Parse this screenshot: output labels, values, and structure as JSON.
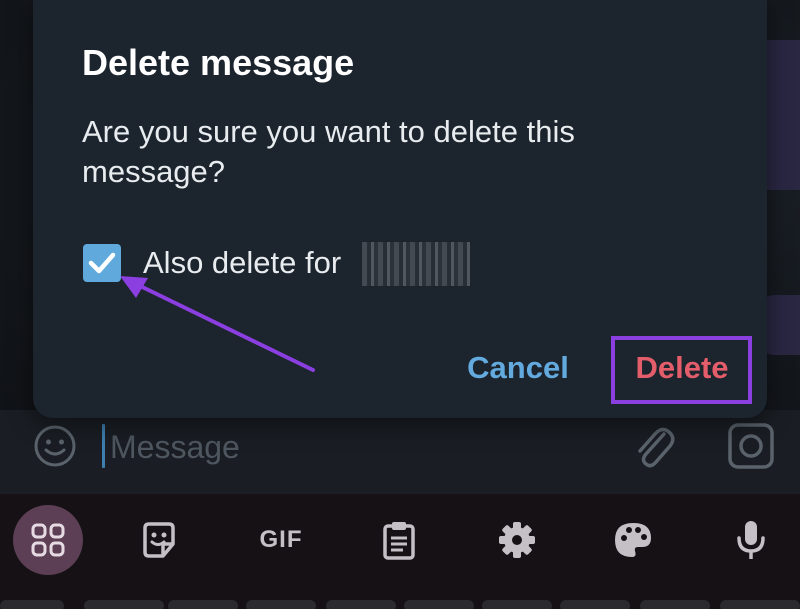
{
  "dialog": {
    "title": "Delete message",
    "message": "Are you sure you want to delete this message?",
    "checkbox_label": "Also delete for",
    "checkbox_checked": true,
    "cancel_label": "Cancel",
    "delete_label": "Delete"
  },
  "composer": {
    "placeholder": "Message"
  },
  "keyboard_toolbar": {
    "gif_label": "GIF",
    "items": [
      "grid-icon",
      "sticker-icon",
      "GIF",
      "clipboard-icon",
      "gear-icon",
      "palette-icon",
      "microphone-icon"
    ]
  },
  "colors": {
    "dialog_bg": "#1c242e",
    "accent_blue": "#63abdf",
    "delete_red": "#e35d6a",
    "annotation_purple": "#8c3fe0",
    "checkbox_blue": "#5fa9dc"
  }
}
